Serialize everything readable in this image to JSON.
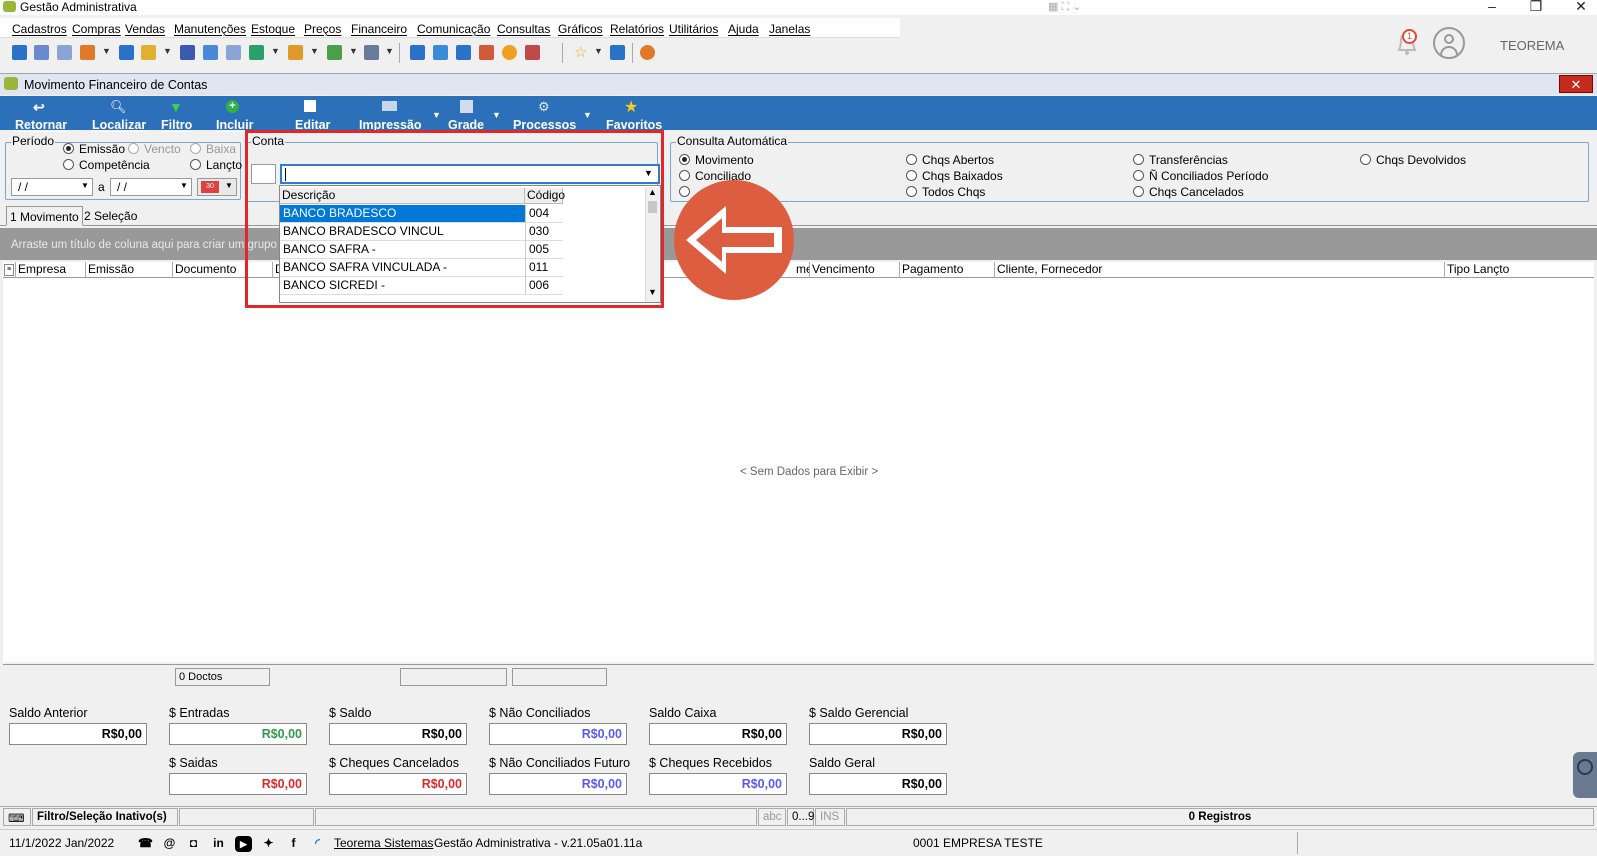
{
  "app": {
    "title": "Gestão Administrativa",
    "brand": "TEOREMA",
    "notif_count": "1"
  },
  "menu": [
    "Cadastros",
    "Compras",
    "Vendas",
    "Manutenções",
    "Estoque",
    "Preços",
    "Financeiro",
    "Comunicação",
    "Consultas",
    "Gráficos",
    "Relatórios",
    "Utilitários",
    "Ajuda",
    "Janelas"
  ],
  "window": {
    "title": "Movimento Financeiro de Contas",
    "close": "✕"
  },
  "ribbon": [
    "Retornar",
    "Localizar",
    "Filtro",
    "Incluir",
    "Editar",
    "Impressão",
    "Grade",
    "Processos",
    "Favoritos"
  ],
  "periodo": {
    "label": "Período",
    "emissao": "Emissão",
    "vencto": "Vencto",
    "baixa": "Baixa",
    "competencia": "Competência",
    "lancto": "Lançto",
    "date_from": "/ /",
    "date_to": "/ /",
    "sep": "a",
    "cal": "30"
  },
  "conta": {
    "label": "Conta",
    "col_desc": "Descrição",
    "col_code": "Código",
    "rows": [
      {
        "desc": "BANCO BRADESCO",
        "code": "004"
      },
      {
        "desc": "BANCO BRADESCO VINCUL",
        "code": "030"
      },
      {
        "desc": "BANCO SAFRA -",
        "code": "005"
      },
      {
        "desc": "BANCO SAFRA VINCULADA -",
        "code": "011"
      },
      {
        "desc": "BANCO SICREDI -",
        "code": "006"
      }
    ]
  },
  "consulta": {
    "label": "Consulta Automática",
    "options": [
      "Movimento",
      "Conciliado",
      "Chqs Abertos",
      "Chqs Baixados",
      "Todos Chqs",
      "Transferências",
      "Ñ Conciliados Período",
      "Chqs Cancelados",
      "Chqs Devolvidos"
    ]
  },
  "tabs": [
    "1 Movimento",
    "2 Seleção"
  ],
  "grid": {
    "group_hint": "Arraste um título de coluna aqui para criar um grupo",
    "columns": [
      "Empresa",
      "Emissão",
      "Documento",
      "D",
      "mento",
      "Vencimento",
      "Pagamento",
      "Cliente, Fornecedor",
      "Tipo Lançto"
    ],
    "empty": "< Sem Dados para Exibir >",
    "doc_count": "0 Doctos"
  },
  "totals": {
    "saldo_anterior": {
      "label": "Saldo Anterior",
      "value": "R$0,00"
    },
    "entradas": {
      "label": "$ Entradas",
      "value": "R$0,00"
    },
    "saldo": {
      "label": "$ Saldo",
      "value": "R$0,00"
    },
    "nao_conciliados": {
      "label": "$ Não Conciliados",
      "value": "R$0,00"
    },
    "saldo_caixa": {
      "label": "Saldo Caixa",
      "value": "R$0,00"
    },
    "saldo_gerencial": {
      "label": "$ Saldo Gerencial",
      "value": "R$0,00"
    },
    "saidas": {
      "label": "$ Saidas",
      "value": "R$0,00"
    },
    "cheques_cancelados": {
      "label": "$ Cheques Cancelados",
      "value": "R$0,00"
    },
    "nao_conciliados_futuro": {
      "label": "$ Não Conciliados Futuro",
      "value": "R$0,00"
    },
    "cheques_recebidos": {
      "label": "$ Cheques Recebidos",
      "value": "R$0,00"
    },
    "saldo_geral": {
      "label": "Saldo Geral",
      "value": "R$0,00"
    }
  },
  "status": {
    "filter": "Filtro/Seleção Inativo(s)",
    "abc": "abc",
    "num": "0...9",
    "ins": "INS",
    "records": "0 Registros",
    "date": "11/1/2022 Jan/2022",
    "company_link": "Teorema Sistemas",
    "version": "Gestão Administrativa - v.21.05a01.11a",
    "empresa": "0001 EMPRESA TESTE"
  },
  "colors": {
    "ribbon": "#2c70b9",
    "entradas": "#2e9b4e",
    "saidas": "#e0282a",
    "blue": "#5a5af0",
    "highlight": "#e0282a",
    "arrow": "#dc5d3f"
  }
}
